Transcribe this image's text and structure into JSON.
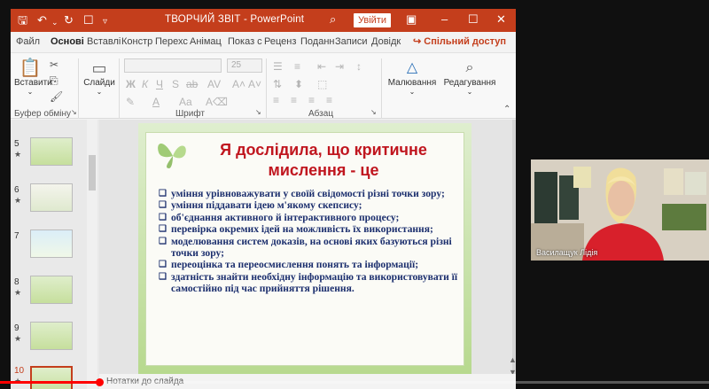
{
  "window": {
    "title": "ТВОРЧИЙ ЗВІТ  -  PowerPoint",
    "signin_label": "Увійти"
  },
  "tabs": [
    "Файл",
    "Основі",
    "Вставлі",
    "Констр",
    "Перехс",
    "Анімац",
    "Показ с",
    "Реценз",
    "Поданн",
    "Записи",
    "Довідк"
  ],
  "share_label": "Спільний доступ",
  "ribbon": {
    "paste_label": "Вставити",
    "slides_label": "Слайди",
    "font_size": "25",
    "drawing_label": "Малювання",
    "editing_label": "Редагування",
    "groups": {
      "clipboard": "Буфер обміну",
      "font": "Шрифт",
      "paragraph": "Абзац"
    }
  },
  "thumbnails": [
    {
      "num": "5",
      "star": "★"
    },
    {
      "num": "6",
      "star": "★"
    },
    {
      "num": "7",
      "star": ""
    },
    {
      "num": "8",
      "star": "★"
    },
    {
      "num": "9",
      "star": "★"
    },
    {
      "num": "10",
      "star": "★"
    }
  ],
  "slide": {
    "title_line1": "Я дослідила, що критичне",
    "title_line2": "мислення - це",
    "bullets": [
      "уміння урівноважувати у своїй свідомості різні точки зору;",
      "уміння піддавати ідею м'якому скепсису;",
      "об'єднання активного й інтерактивного процесу;",
      "перевірка окремих ідей на можливість їх використання;",
      "моделювання систем доказів, на основі яких базуються різні точки зору;",
      "переоцінка та переосмислення понять та інформації;",
      "здатність знайти необхідну інформацію та використовувати її самостійно під час прийняття рішення."
    ]
  },
  "status_text": "Нотатки до слайда",
  "webcam": {
    "participant_name": "Василащук Лідія"
  },
  "video": {
    "progress_fraction": 0.14
  },
  "colors": {
    "accent": "#c43e1c",
    "title_red": "#c0161f",
    "bullet_blue": "#1c2f6e",
    "progress_red": "#ff0000"
  }
}
